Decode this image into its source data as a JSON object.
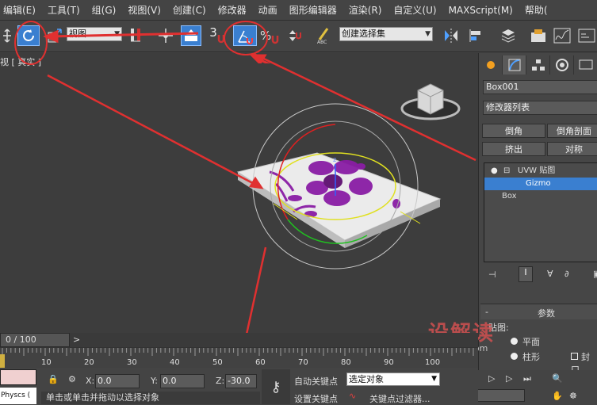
{
  "menubar": {
    "items": [
      "编辑(E)",
      "工具(T)",
      "组(G)",
      "视图(V)",
      "创建(C)",
      "修改器",
      "动画",
      "图形编辑器",
      "渲染(R)",
      "自定义(U)",
      "MAXScript(M)",
      "帮助("
    ]
  },
  "toolbar": {
    "view_select": "视图",
    "snap_value": "3",
    "selection_set": "创建选择集"
  },
  "viewport": {
    "label": "视 [ 真实 ]",
    "gizmo_axis": "z"
  },
  "command_panel": {
    "object_name": "Box001",
    "modifier_list": "修改器列表",
    "buttons": [
      "倒角",
      "倒角剖面",
      "挤出",
      "对称"
    ],
    "stack": [
      {
        "label": "UVW 贴图",
        "expand": "⊟",
        "bulb": true,
        "selected": false
      },
      {
        "label": "Gizmo",
        "expand": "",
        "bulb": false,
        "selected": true
      },
      {
        "label": "Box",
        "expand": "",
        "bulb": false,
        "selected": false
      }
    ],
    "params_title": "参数",
    "params_section": "贴图:",
    "radio_plane": "平面",
    "radio_cylinder": "柱形",
    "checkbox_cap": "封口"
  },
  "timeline": {
    "frame_display": "0 / 100",
    "next": ">",
    "ticks": [
      "10",
      "20",
      "30",
      "40",
      "50",
      "60",
      "70",
      "80",
      "90",
      "100"
    ]
  },
  "status": {
    "physcs": "Physcs (",
    "x_label": "X:",
    "x_value": "0.0",
    "y_label": "Y:",
    "y_value": "0.0",
    "z_label": "Z:",
    "z_value": "-30.0",
    "auto_key": "自动关键点",
    "set_key": "设置关键点",
    "selected_object": "选定对象",
    "key_filter": "关键点过滤器...",
    "prompt": "单击或单击并拖动以选择对象",
    "frame": "0"
  },
  "watermark": {
    "brand": "设解读",
    "url": "shejiedu.com"
  },
  "colors": {
    "accent_blue": "#3a7fd0",
    "annotation_red": "#e03030",
    "flower_purple": "#8a1da5"
  }
}
